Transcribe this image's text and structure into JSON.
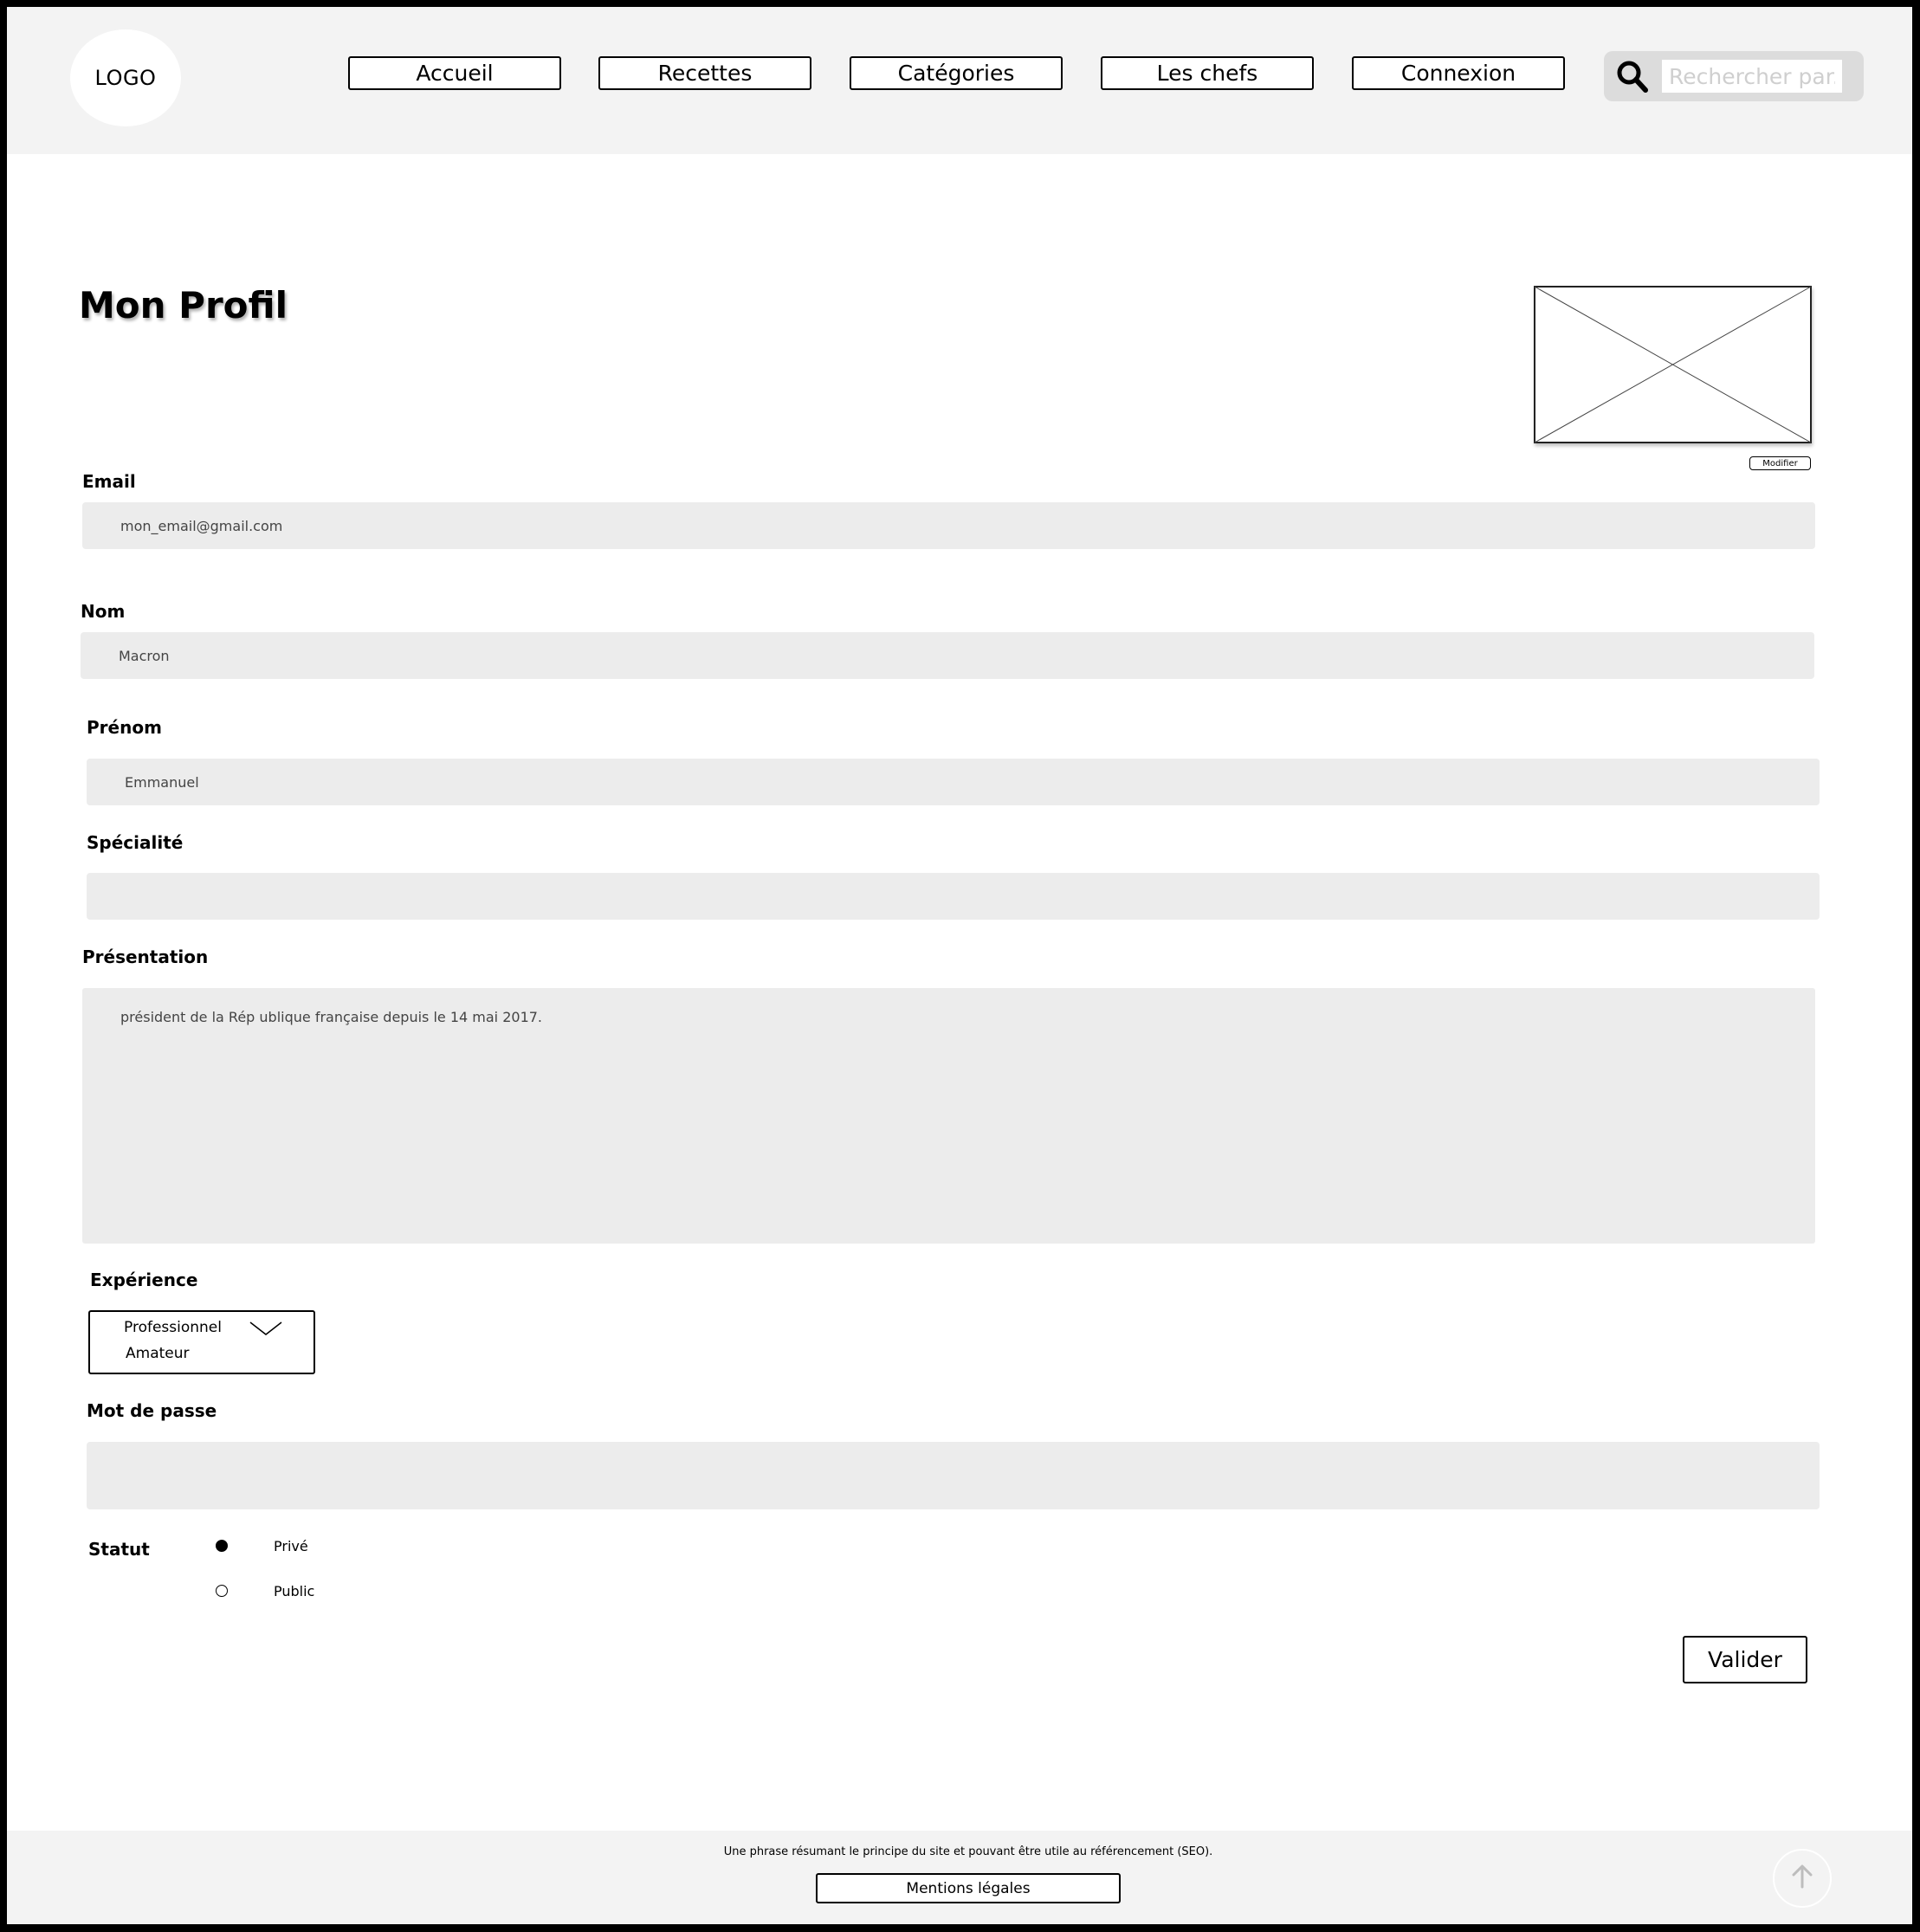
{
  "header": {
    "logo": "LOGO",
    "nav": [
      "Accueil",
      "Recettes",
      "Catégories",
      "Les chefs",
      "Connexion"
    ],
    "search": {
      "placeholder": "Rechercher par...",
      "icon": "search-icon"
    }
  },
  "main": {
    "title": "Mon Profil",
    "photo": {
      "icon": "image-placeholder-icon",
      "modifier_label": "Modifier"
    },
    "email": {
      "label": "Email",
      "value": "mon_email@gmail.com"
    },
    "nom": {
      "label": "Nom",
      "value": "Macron"
    },
    "prenom": {
      "label": "Prénom",
      "value": "Emmanuel"
    },
    "specialite": {
      "label": "Spécialité",
      "value": ""
    },
    "presentation": {
      "label": "Présentation",
      "value": "président de la Rép ublique française depuis le 14 mai 2017."
    },
    "experience": {
      "label": "Expérience",
      "options": [
        "Professionnel",
        "Amateur"
      ],
      "icon": "chevron-down-icon"
    },
    "password": {
      "label": "Mot de passe",
      "value": ""
    },
    "statut": {
      "label": "Statut",
      "options": [
        {
          "label": "Privé",
          "checked": true
        },
        {
          "label": "Public",
          "checked": false
        }
      ]
    },
    "submit_label": "Valider"
  },
  "footer": {
    "text": "Une phrase résumant le principe du site et pouvant être utile au référencement (SEO).",
    "legal_label": "Mentions légales",
    "top_icon": "arrow-up-icon"
  },
  "colors": {
    "header_bg": "#f3f3f3",
    "field_bg": "#ececec",
    "search_bg": "#dcdcdc",
    "border": "#000000"
  }
}
